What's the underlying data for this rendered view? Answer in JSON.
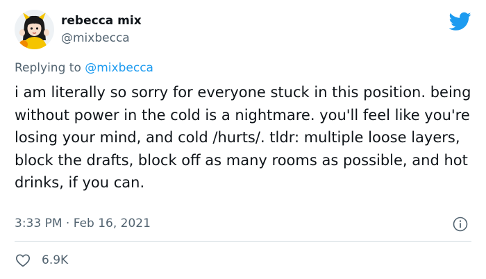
{
  "author": {
    "display_name": "rebecca mix",
    "handle": "@mixbecca",
    "avatar_icon": "cartoon-avatar-icon"
  },
  "platform_icon": "twitter-bird-icon",
  "brand_color": "#1d9bf0",
  "reply": {
    "prefix": "Replying to ",
    "target": "@mixbecca"
  },
  "tweet": {
    "text": "i am literally so sorry for everyone stuck in this position. being without power in the cold is a nightmare. you'll feel like you're losing your mind, and cold /hurts/. tldr: multiple loose layers, block the drafts, block off as many rooms as possible, and hot drinks, if you can.",
    "time": "3:33 PM",
    "separator": " · ",
    "date": "Feb 16, 2021"
  },
  "actions": {
    "info_icon": "info-icon",
    "like_icon": "heart-icon",
    "like_count": "6.9K"
  }
}
